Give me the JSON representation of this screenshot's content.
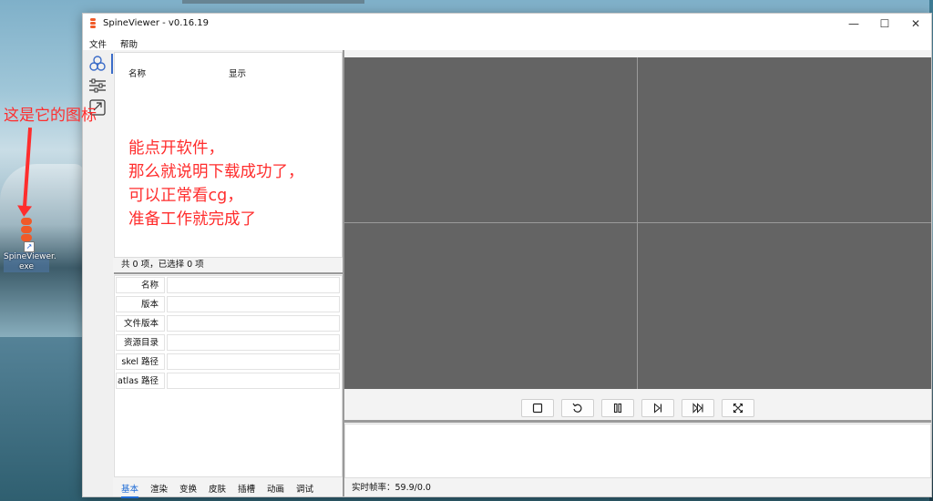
{
  "desktop": {
    "annotation": "这是它的图标",
    "icon_label_line1": "SpineViewer.",
    "icon_label_line2": "exe"
  },
  "window": {
    "title": "SpineViewer - v0.16.19",
    "controls": {
      "minimize": "—",
      "maximize": "☐",
      "close": "✕"
    }
  },
  "menu": [
    {
      "label": "文件"
    },
    {
      "label": "帮助"
    }
  ],
  "sidebar": {
    "tools": [
      "spine-list-icon",
      "settings-sliders-icon",
      "export-icon"
    ]
  },
  "list_panel": {
    "columns": {
      "name": "名称",
      "display": "显示"
    },
    "annotation_lines": [
      "能点开软件，",
      "那么就说明下载成功了，",
      "可以正常看cg，",
      "准备工作就完成了"
    ],
    "count_text": "共 0 项，已选择 0 项"
  },
  "properties": {
    "rows": [
      {
        "key": "名称",
        "value": ""
      },
      {
        "key": "版本",
        "value": ""
      },
      {
        "key": "文件版本",
        "value": ""
      },
      {
        "key": "资源目录",
        "value": ""
      },
      {
        "key": "skel 路径",
        "value": ""
      },
      {
        "key": "atlas 路径",
        "value": ""
      }
    ]
  },
  "tabs": [
    {
      "label": "基本",
      "active": true
    },
    {
      "label": "渲染"
    },
    {
      "label": "变换"
    },
    {
      "label": "皮肤"
    },
    {
      "label": "插槽"
    },
    {
      "label": "动画"
    },
    {
      "label": "调试"
    }
  ],
  "playback": {
    "buttons": [
      "stop-icon",
      "restart-icon",
      "pause-icon",
      "step-forward-icon",
      "fast-forward-icon",
      "fullscreen-icon"
    ]
  },
  "status": {
    "fps_text": "实时帧率：59.9/0.0"
  },
  "colors": {
    "accent": "#1e6bd6",
    "annotation": "#ff2d2d",
    "preview_bg": "#646464",
    "brand": "#f05a28"
  }
}
